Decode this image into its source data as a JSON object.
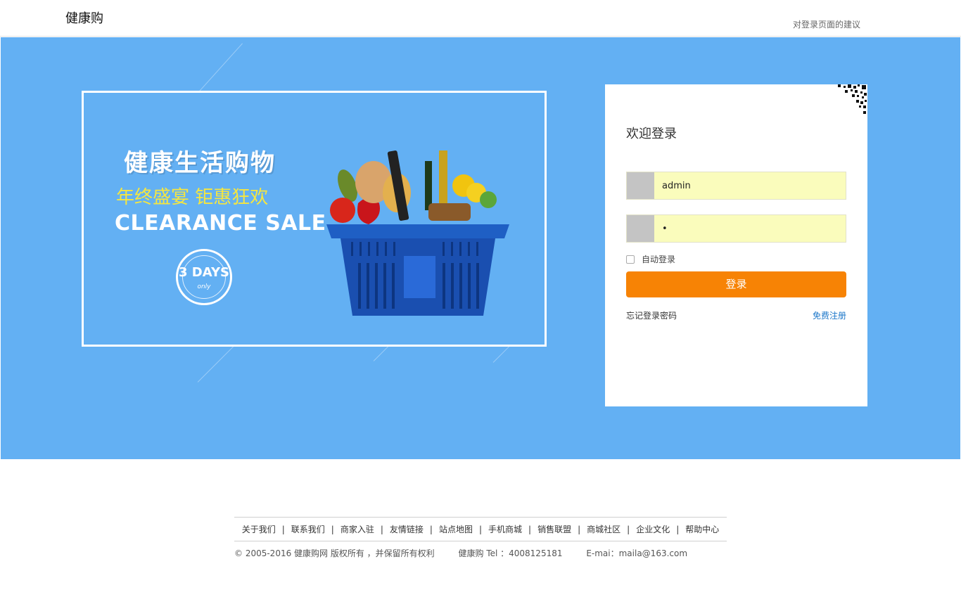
{
  "header": {
    "logo": "健康购",
    "suggest_link": "对登录页面的建议"
  },
  "promo": {
    "title": "健康生活购物",
    "subtitle": "年终盛宴 钜惠狂欢",
    "sale": "CLEARANCE SALE",
    "stamp_days": "3 DAYS",
    "stamp_only": "only"
  },
  "login": {
    "title": "欢迎登录",
    "username": "admin",
    "password": "•",
    "remember_label": "自动登录",
    "submit_label": "登录",
    "forgot_label": "忘记登录密码",
    "register_label": "免费注册"
  },
  "footer": {
    "links": [
      "关于我们",
      "联系我们",
      "商家入驻",
      "友情链接",
      "站点地图",
      "手机商城",
      "销售联盟",
      "商城社区",
      "企业文化",
      "帮助中心"
    ],
    "copyright": "©  2005-2016 健康购网 版权所有 ，并保留所有权利",
    "tel": "健康购 Tel ：4008125181",
    "email": "E-mai：maila@163.com"
  },
  "colors": {
    "banner_bg": "#63b0f3",
    "button_bg": "#f78305",
    "input_bg": "#fafcbc",
    "link_blue": "#1c77c9"
  }
}
